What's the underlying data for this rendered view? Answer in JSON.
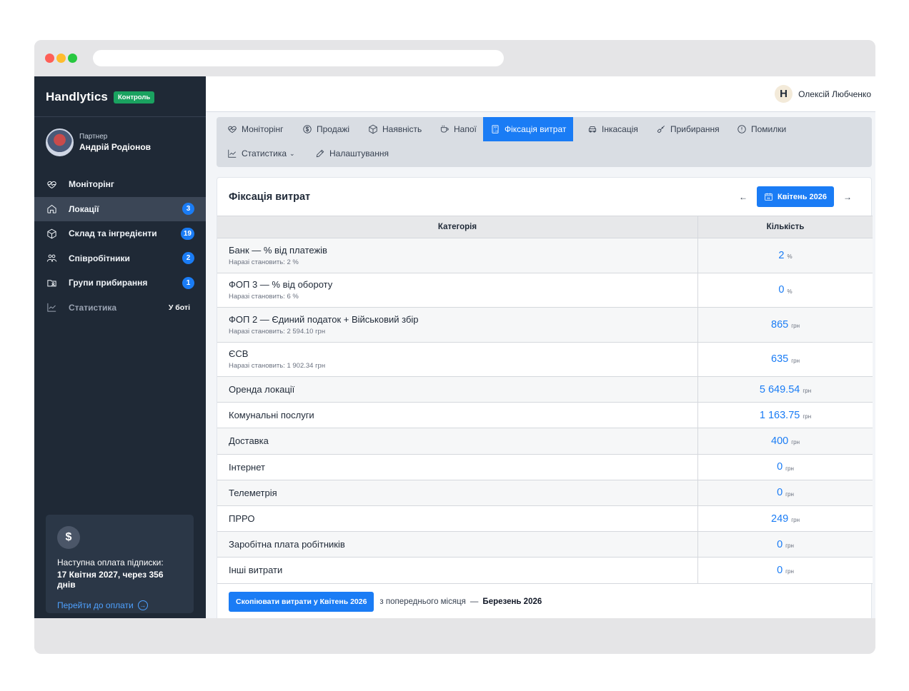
{
  "app": {
    "name": "Handlytics",
    "badge": "Контроль"
  },
  "profile": {
    "role": "Партнер",
    "name": "Андрій Родіонов"
  },
  "sidebar": {
    "items": [
      {
        "label": "Моніторінг",
        "icon": "heart-pulse-icon",
        "badge": ""
      },
      {
        "label": "Локації",
        "icon": "home-icon",
        "badge": "3"
      },
      {
        "label": "Склад та інгредієнти",
        "icon": "box-icon",
        "badge": "19"
      },
      {
        "label": "Співробітники",
        "icon": "users-icon",
        "badge": "2"
      },
      {
        "label": "Групи прибирання",
        "icon": "folder-user-icon",
        "badge": "1"
      },
      {
        "label": "Статистика",
        "icon": "chart-line-icon",
        "tag": "У боті"
      }
    ]
  },
  "subscription": {
    "icon": "$",
    "title": "Наступна оплата підписки:",
    "date": "17 Квітня 2027, через 356 днів",
    "link": "Перейти до оплати"
  },
  "user": {
    "logo": "H",
    "name": "Олексій Любченко"
  },
  "tabs": [
    {
      "label": "Моніторінг",
      "icon": "heart-pulse-icon"
    },
    {
      "label": "Продажі",
      "icon": "dollar-circle-icon"
    },
    {
      "label": "Наявність",
      "icon": "box-icon"
    },
    {
      "label": "Напої",
      "icon": "cup-icon"
    },
    {
      "label": "Фіксація витрат",
      "icon": "calculator-icon",
      "active": true
    },
    {
      "label": "Інкасація",
      "icon": "car-icon"
    },
    {
      "label": "Прибирання",
      "icon": "brush-icon"
    },
    {
      "label": "Помилки",
      "icon": "alert-circle-icon"
    },
    {
      "label": "Статистика",
      "icon": "chart-line-icon",
      "dropdown": true
    },
    {
      "label": "Налаштування",
      "icon": "pencil-icon"
    }
  ],
  "expenses": {
    "title": "Фіксація витрат",
    "month": "Квітень 2026",
    "prev_arrow": "←",
    "next_arrow": "→",
    "columns": {
      "category": "Категорія",
      "quantity": "Кількість"
    },
    "rows": [
      {
        "name": "Банк — % від платежів",
        "note": "Наразі становить: 2 %",
        "value": "2",
        "unit": "%"
      },
      {
        "name": "ФОП 3 — % від обороту",
        "note": "Наразі становить: 6 %",
        "value": "0",
        "unit": "%"
      },
      {
        "name": "ФОП 2 — Єдиний податок + Військовий збір",
        "note": "Наразі становить: 2 594.10 грн",
        "value": "865",
        "unit": "грн"
      },
      {
        "name": "ЄСВ",
        "note": "Наразі становить: 1 902.34 грн",
        "value": "635",
        "unit": "грн"
      },
      {
        "name": "Оренда локації",
        "note": "",
        "value": "5 649.54",
        "unit": "грн"
      },
      {
        "name": "Комунальні послуги",
        "note": "",
        "value": "1 163.75",
        "unit": "грн"
      },
      {
        "name": "Доставка",
        "note": "",
        "value": "400",
        "unit": "грн"
      },
      {
        "name": "Інтернет",
        "note": "",
        "value": "0",
        "unit": "грн"
      },
      {
        "name": "Телеметрія",
        "note": "",
        "value": "0",
        "unit": "грн"
      },
      {
        "name": "ПРРО",
        "note": "",
        "value": "249",
        "unit": "грн"
      },
      {
        "name": "Заробітна плата робітників",
        "note": "",
        "value": "0",
        "unit": "грн"
      },
      {
        "name": "Інші витрати",
        "note": "",
        "value": "0",
        "unit": "грн"
      }
    ],
    "copy_button": "Скопіювати витрати у Квітень 2026",
    "copy_text": "з попереднього місяця",
    "copy_dash": "—",
    "copy_prev_month": "Березень 2026"
  }
}
